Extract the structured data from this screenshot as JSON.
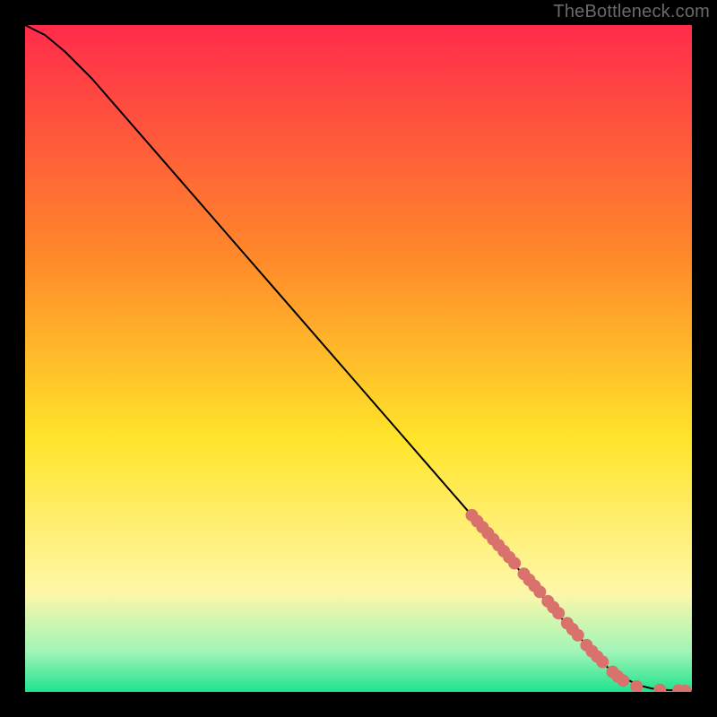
{
  "attribution": "TheBottleneck.com",
  "colors": {
    "curve": "#000000",
    "marker": "#d9716c",
    "frame": "#000000",
    "gradient_top": "#ff2b4b",
    "gradient_mid1": "#ff8a2a",
    "gradient_mid2": "#ffe42a",
    "gradient_mid3": "#fff7a8",
    "gradient_mid4": "#9ff5b8",
    "gradient_bottom": "#1fe28d"
  },
  "chart_data": {
    "type": "line",
    "title": "",
    "xlabel": "",
    "ylabel": "",
    "xlim": [
      0,
      100
    ],
    "ylim": [
      0,
      100
    ],
    "series": [
      {
        "name": "curve",
        "x": [
          0,
          3,
          6,
          10,
          20,
          30,
          40,
          50,
          60,
          70,
          80,
          88,
          92,
          94,
          96,
          98,
          100
        ],
        "y": [
          100,
          98.5,
          96,
          92,
          80.5,
          69,
          57.5,
          46,
          34.5,
          23,
          11.5,
          3,
          1,
          0.5,
          0.3,
          0.2,
          0.15
        ]
      }
    ],
    "markers": [
      {
        "x": 67.0,
        "y": 26.5
      },
      {
        "x": 67.8,
        "y": 25.6
      },
      {
        "x": 68.6,
        "y": 24.7
      },
      {
        "x": 69.4,
        "y": 23.8
      },
      {
        "x": 70.2,
        "y": 22.9
      },
      {
        "x": 71.0,
        "y": 22.0
      },
      {
        "x": 71.8,
        "y": 21.1
      },
      {
        "x": 72.6,
        "y": 20.2
      },
      {
        "x": 73.4,
        "y": 19.3
      },
      {
        "x": 74.8,
        "y": 17.7
      },
      {
        "x": 75.6,
        "y": 16.8
      },
      {
        "x": 76.4,
        "y": 15.9
      },
      {
        "x": 77.2,
        "y": 15.0
      },
      {
        "x": 78.4,
        "y": 13.6
      },
      {
        "x": 79.2,
        "y": 12.7
      },
      {
        "x": 80.0,
        "y": 11.8
      },
      {
        "x": 81.3,
        "y": 10.3
      },
      {
        "x": 82.1,
        "y": 9.4
      },
      {
        "x": 82.9,
        "y": 8.5
      },
      {
        "x": 84.2,
        "y": 7.0
      },
      {
        "x": 85.0,
        "y": 6.1
      },
      {
        "x": 85.8,
        "y": 5.3
      },
      {
        "x": 86.6,
        "y": 4.5
      },
      {
        "x": 88.1,
        "y": 3.0
      },
      {
        "x": 88.9,
        "y": 2.3
      },
      {
        "x": 89.7,
        "y": 1.7
      },
      {
        "x": 91.7,
        "y": 0.8
      },
      {
        "x": 95.2,
        "y": 0.3
      },
      {
        "x": 98.0,
        "y": 0.2
      },
      {
        "x": 99.0,
        "y": 0.15
      }
    ]
  }
}
